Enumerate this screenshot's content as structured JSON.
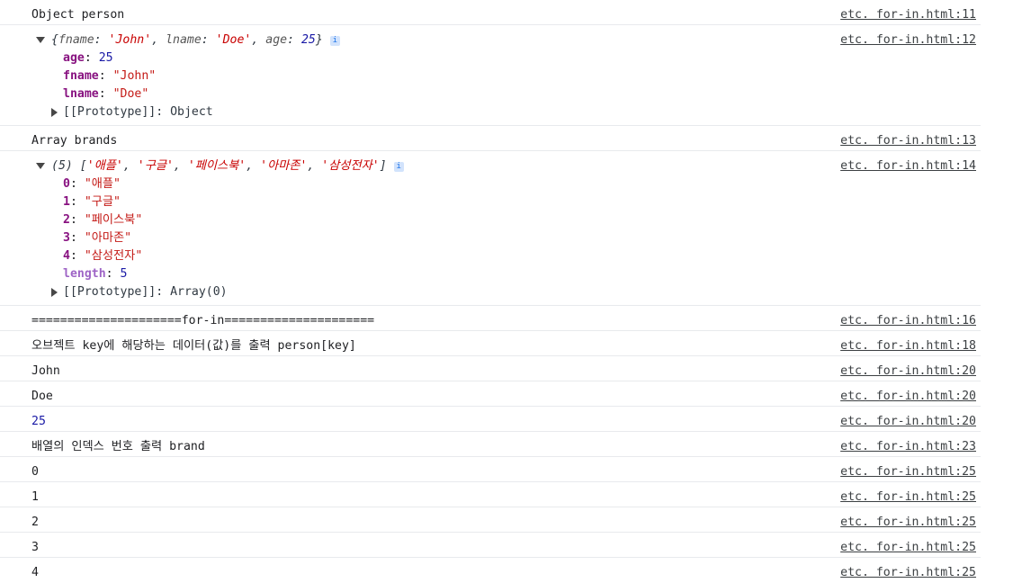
{
  "log": [
    {
      "text": "Object person",
      "source": "etc. for-in.html:11"
    },
    {
      "source": "etc. for-in.html:12",
      "object": {
        "preview_open": "{",
        "entries": [
          {
            "key": "fname",
            "value": "'John'"
          },
          {
            "key": "lname",
            "value": "'Doe'"
          },
          {
            "key": "age",
            "value": "25"
          }
        ],
        "preview_close": "}",
        "props": [
          {
            "key": "age",
            "value": "25"
          },
          {
            "key": "fname",
            "value": "\"John\""
          },
          {
            "key": "lname",
            "value": "\"Doe\""
          }
        ],
        "prototype_label": "[[Prototype]]",
        "prototype_value": "Object"
      }
    },
    {
      "text": "Array brands",
      "source": "etc. for-in.html:13"
    },
    {
      "source": "etc. for-in.html:14",
      "array": {
        "count_label": "(5)",
        "items_preview": [
          "'애플'",
          "'구글'",
          "'페이스북'",
          "'아마존'",
          "'삼성전자'"
        ],
        "props": [
          {
            "key": "0",
            "value": "\"애플\""
          },
          {
            "key": "1",
            "value": "\"구글\""
          },
          {
            "key": "2",
            "value": "\"페이스북\""
          },
          {
            "key": "3",
            "value": "\"아마존\""
          },
          {
            "key": "4",
            "value": "\"삼성전자\""
          }
        ],
        "length_key": "length",
        "length_value": "5",
        "prototype_label": "[[Prototype]]",
        "prototype_value": "Array(0)"
      }
    },
    {
      "text": "=====================for-in=====================",
      "source": "etc. for-in.html:16"
    },
    {
      "text": "오브젝트 key에 해당하는 데이터(값)를 출력 person[key]",
      "source": "etc. for-in.html:18"
    },
    {
      "text": "John",
      "source": "etc. for-in.html:20"
    },
    {
      "text": "Doe",
      "source": "etc. for-in.html:20"
    },
    {
      "text": "25",
      "source": "etc. for-in.html:20",
      "numeric": true
    },
    {
      "text": "배열의 인덱스 번호 출력 brand",
      "source": "etc. for-in.html:23"
    },
    {
      "text": "0",
      "source": "etc. for-in.html:25"
    },
    {
      "text": "1",
      "source": "etc. for-in.html:25"
    },
    {
      "text": "2",
      "source": "etc. for-in.html:25"
    },
    {
      "text": "3",
      "source": "etc. for-in.html:25"
    },
    {
      "text": "4",
      "source": "etc. for-in.html:25"
    }
  ],
  "info_icon_glyph": "i",
  "colors": {
    "string": "#c41a16",
    "number": "#1a1aa6",
    "key": "#881280",
    "divider": "#e8eaed"
  }
}
